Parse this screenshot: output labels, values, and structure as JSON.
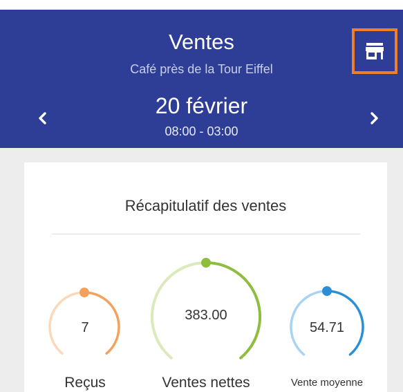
{
  "header": {
    "title": "Ventes",
    "subtitle": "Café près de la Tour Eiffel",
    "date": "20  février",
    "hours": "08:00 - 03:00",
    "store_icon": "store-icon",
    "prev_icon": "chevron-left-icon",
    "next_icon": "chevron-right-icon"
  },
  "summary": {
    "title": "Récapitulatif des ventes",
    "metrics": [
      {
        "value": "7",
        "label": "Reçus",
        "color": "#f5a15d",
        "track_color": "#fcd8b8"
      },
      {
        "value": "383.00",
        "label": "Ventes nettes",
        "color": "#8fbd3e",
        "track_color": "#dbeaba"
      },
      {
        "value": "54.71",
        "label": "Vente moyenne",
        "color": "#2a8fd6",
        "track_color": "#a9d3f2"
      }
    ]
  },
  "colors": {
    "header_bg": "#2e3e96",
    "store_highlight": "#f07f2a",
    "page_bg": "#ededed"
  }
}
